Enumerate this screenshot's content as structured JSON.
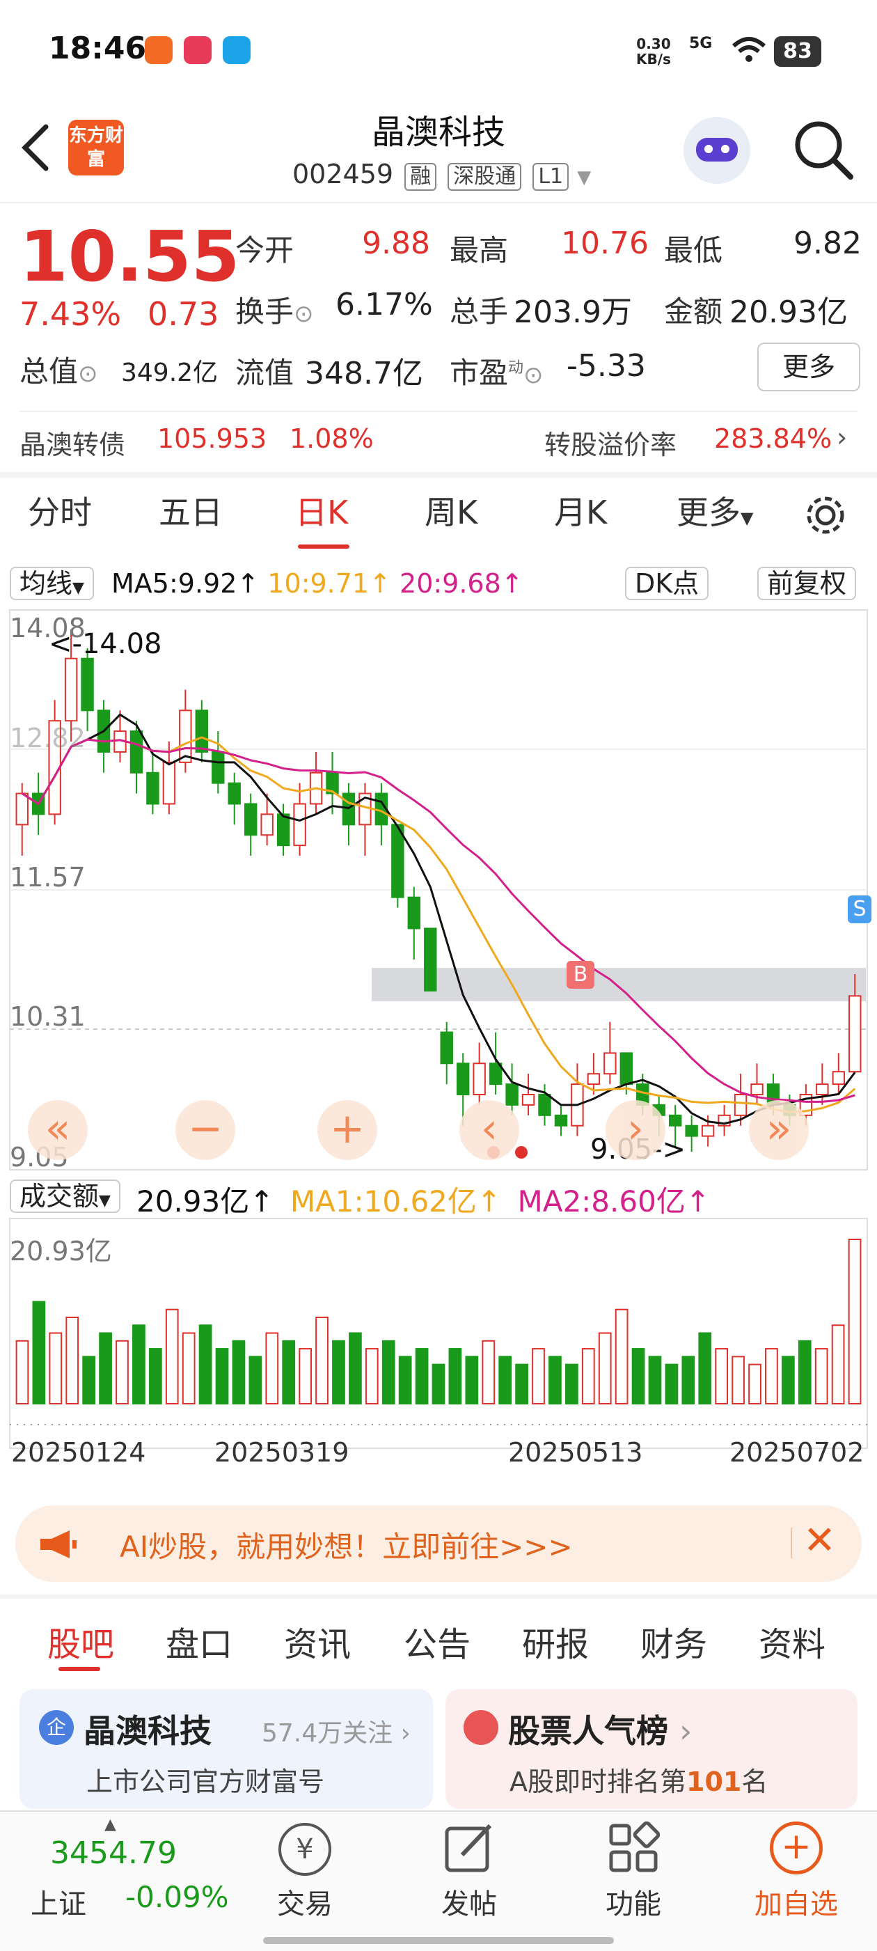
{
  "status_bar": {
    "time": "18:46",
    "net_speed": "0.30",
    "net_unit": "KB/s",
    "signal": "5G",
    "battery": "83"
  },
  "header": {
    "title": "晶澳科技",
    "code": "002459",
    "tags": [
      "融",
      "深股通",
      "L1"
    ],
    "logo_text": "东方财富"
  },
  "quote": {
    "price": "10.55",
    "change_pct": "7.43%",
    "change_amt": "0.73",
    "open_label": "今开",
    "open": "9.88",
    "high_label": "最高",
    "high": "10.76",
    "low_label": "最低",
    "low": "9.82",
    "turnover_label": "换手",
    "turnover": "6.17%",
    "volume_label": "总手",
    "volume": "203.9万",
    "amount_label": "金额",
    "amount": "20.93亿",
    "mcap_label": "总值",
    "mcap": "349.2亿",
    "float_label": "流值",
    "float": "348.7亿",
    "pe_label": "市盈",
    "pe_sup": "动",
    "pe": "-5.33",
    "more": "更多"
  },
  "bond": {
    "name": "晶澳转债",
    "price": "105.953",
    "pct": "1.08%",
    "premium_label": "转股溢价率",
    "premium": "283.84%"
  },
  "chart_tabs": [
    "分时",
    "五日",
    "日K",
    "周K",
    "月K",
    "更多"
  ],
  "active_chart_tab": "日K",
  "kline": {
    "indicator": "均线",
    "ma5": "MA5:9.92",
    "ma10": "10:9.71",
    "ma20": "20:9.68",
    "dk": "DK点",
    "adjust": "前复权",
    "y_labels": [
      "14.08",
      "11.57",
      "10.31",
      "9.05"
    ],
    "y_label_partial": "12.82",
    "max_marker": "<-14.08",
    "min_marker": "9.05->",
    "b_marker": "B",
    "s_marker": "S"
  },
  "volume_panel": {
    "indicator": "成交额",
    "value": "20.93亿",
    "ma1": "MA1:10.62亿",
    "ma2": "MA2:8.60亿",
    "max_label": "20.93亿",
    "dates": [
      "20250124",
      "20250319",
      "20250513",
      "20250702"
    ]
  },
  "chart_data": {
    "type": "candlestick",
    "ylim": [
      9.05,
      14.08
    ],
    "candles": [
      {
        "o": 12.2,
        "c": 12.5,
        "h": 12.6,
        "l": 11.9
      },
      {
        "o": 12.5,
        "c": 12.3,
        "h": 12.7,
        "l": 12.1
      },
      {
        "o": 12.3,
        "c": 13.2,
        "h": 13.4,
        "l": 12.2
      },
      {
        "o": 13.2,
        "c": 13.8,
        "h": 14.08,
        "l": 13.0
      },
      {
        "o": 13.8,
        "c": 13.3,
        "h": 13.9,
        "l": 13.1
      },
      {
        "o": 13.3,
        "c": 12.9,
        "h": 13.4,
        "l": 12.7
      },
      {
        "o": 12.9,
        "c": 13.1,
        "h": 13.3,
        "l": 12.8
      },
      {
        "o": 13.1,
        "c": 12.7,
        "h": 13.2,
        "l": 12.5
      },
      {
        "o": 12.7,
        "c": 12.4,
        "h": 12.9,
        "l": 12.3
      },
      {
        "o": 12.4,
        "c": 12.8,
        "h": 13.0,
        "l": 12.3
      },
      {
        "o": 12.8,
        "c": 13.3,
        "h": 13.5,
        "l": 12.7
      },
      {
        "o": 13.3,
        "c": 12.9,
        "h": 13.4,
        "l": 12.8
      },
      {
        "o": 12.9,
        "c": 12.6,
        "h": 13.1,
        "l": 12.5
      },
      {
        "o": 12.6,
        "c": 12.4,
        "h": 12.7,
        "l": 12.2
      },
      {
        "o": 12.4,
        "c": 12.1,
        "h": 12.5,
        "l": 11.9
      },
      {
        "o": 12.1,
        "c": 12.3,
        "h": 12.5,
        "l": 12.0
      },
      {
        "o": 12.3,
        "c": 12.0,
        "h": 12.4,
        "l": 11.9
      },
      {
        "o": 12.0,
        "c": 12.4,
        "h": 12.6,
        "l": 11.9
      },
      {
        "o": 12.4,
        "c": 12.7,
        "h": 12.9,
        "l": 12.3
      },
      {
        "o": 12.7,
        "c": 12.5,
        "h": 12.9,
        "l": 12.3
      },
      {
        "o": 12.5,
        "c": 12.2,
        "h": 12.6,
        "l": 12.0
      },
      {
        "o": 12.2,
        "c": 12.5,
        "h": 12.6,
        "l": 11.9
      },
      {
        "o": 12.5,
        "c": 12.2,
        "h": 12.6,
        "l": 12.0
      },
      {
        "o": 12.2,
        "c": 11.5,
        "h": 12.2,
        "l": 11.4
      },
      {
        "o": 11.5,
        "c": 11.2,
        "h": 11.6,
        "l": 10.9
      },
      {
        "o": 11.2,
        "c": 10.6,
        "h": 11.2,
        "l": 10.6
      },
      {
        "o": 10.2,
        "c": 9.9,
        "h": 10.3,
        "l": 9.7
      },
      {
        "o": 9.9,
        "c": 9.6,
        "h": 10.0,
        "l": 9.3
      },
      {
        "o": 9.6,
        "c": 9.9,
        "h": 10.1,
        "l": 9.5
      },
      {
        "o": 9.9,
        "c": 9.7,
        "h": 10.2,
        "l": 9.6
      },
      {
        "o": 9.7,
        "c": 9.5,
        "h": 9.9,
        "l": 9.4
      },
      {
        "o": 9.5,
        "c": 9.6,
        "h": 9.8,
        "l": 9.4
      },
      {
        "o": 9.6,
        "c": 9.4,
        "h": 9.7,
        "l": 9.3
      },
      {
        "o": 9.4,
        "c": 9.3,
        "h": 9.5,
        "l": 9.2
      },
      {
        "o": 9.3,
        "c": 9.7,
        "h": 9.9,
        "l": 9.2
      },
      {
        "o": 9.7,
        "c": 9.8,
        "h": 10.0,
        "l": 9.6
      },
      {
        "o": 9.8,
        "c": 10.0,
        "h": 10.3,
        "l": 9.7
      },
      {
        "o": 10.0,
        "c": 9.7,
        "h": 10.0,
        "l": 9.6
      },
      {
        "o": 9.7,
        "c": 9.5,
        "h": 9.8,
        "l": 9.4
      },
      {
        "o": 9.5,
        "c": 9.4,
        "h": 9.6,
        "l": 9.2
      },
      {
        "o": 9.4,
        "c": 9.3,
        "h": 9.5,
        "l": 9.1
      },
      {
        "o": 9.3,
        "c": 9.2,
        "h": 9.4,
        "l": 9.05
      },
      {
        "o": 9.2,
        "c": 9.3,
        "h": 9.4,
        "l": 9.1
      },
      {
        "o": 9.3,
        "c": 9.4,
        "h": 9.5,
        "l": 9.2
      },
      {
        "o": 9.4,
        "c": 9.6,
        "h": 9.8,
        "l": 9.3
      },
      {
        "o": 9.6,
        "c": 9.7,
        "h": 9.9,
        "l": 9.5
      },
      {
        "o": 9.7,
        "c": 9.5,
        "h": 9.8,
        "l": 9.4
      },
      {
        "o": 9.5,
        "c": 9.4,
        "h": 9.6,
        "l": 9.3
      },
      {
        "o": 9.4,
        "c": 9.6,
        "h": 9.7,
        "l": 9.3
      },
      {
        "o": 9.6,
        "c": 9.7,
        "h": 9.9,
        "l": 9.5
      },
      {
        "o": 9.7,
        "c": 9.82,
        "h": 10.0,
        "l": 9.6
      },
      {
        "o": 9.82,
        "c": 10.55,
        "h": 10.76,
        "l": 9.82
      }
    ],
    "volumes": [
      8,
      13,
      9,
      11,
      6,
      9,
      8,
      10,
      7,
      12,
      9,
      10,
      7,
      8,
      6,
      9,
      8,
      7,
      11,
      8,
      9,
      7,
      8,
      6,
      7,
      5,
      7,
      6,
      8,
      6,
      5,
      7,
      6,
      5,
      7,
      9,
      12,
      7,
      6,
      5,
      6,
      9,
      7,
      6,
      5,
      7,
      6,
      8,
      7,
      10,
      20.93
    ],
    "vol_ylim": [
      0,
      20.93
    ],
    "bands": [
      {
        "from": 10.5,
        "to": 10.82
      }
    ]
  },
  "banner": {
    "text": "AI炒股，就用妙想！立即前往>>>"
  },
  "bottom_tabs": [
    "股吧",
    "盘口",
    "资讯",
    "公告",
    "研报",
    "财务",
    "资料"
  ],
  "active_bottom_tab": "股吧",
  "cards": [
    {
      "title": "晶澳科技",
      "meta": "57.4万关注",
      "sub": "上市公司官方财富号"
    },
    {
      "title": "股票人气榜",
      "sub_pre": "A股即时排名第",
      "rank": "101",
      "sub_post": "名"
    }
  ],
  "index": {
    "value": "3454.79",
    "name": "上证",
    "change": "-0.09%"
  },
  "nav": [
    "交易",
    "发帖",
    "功能",
    "加自选"
  ],
  "colors": {
    "up": "#e0302b",
    "down": "#1a9a1a",
    "brand": "#f05a22",
    "ma5": "#111111",
    "ma10": "#f0a81e",
    "ma20": "#d4208a"
  }
}
